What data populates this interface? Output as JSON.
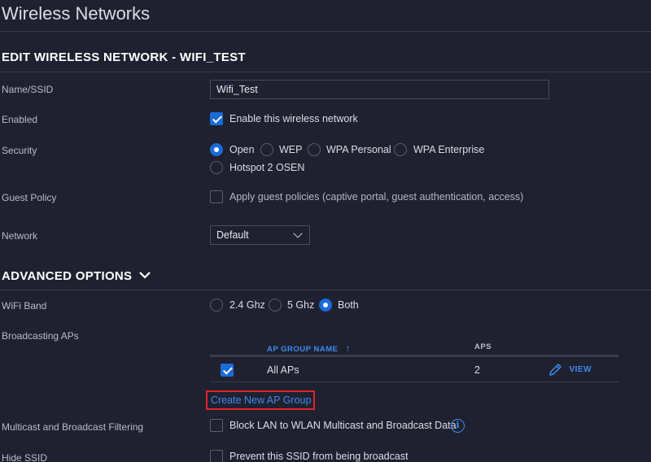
{
  "page": {
    "title": "Wireless Networks"
  },
  "edit": {
    "heading": "EDIT WIRELESS NETWORK - WIFI_TEST"
  },
  "ssid": {
    "label": "Name/SSID",
    "value": "Wifi_Test"
  },
  "enabled": {
    "label": "Enabled",
    "checkbox_label": "Enable this wireless network",
    "checked": true
  },
  "security": {
    "label": "Security",
    "options": [
      "Open",
      "WEP",
      "WPA Personal",
      "WPA Enterprise",
      "Hotspot 2 OSEN"
    ],
    "selected": "Open"
  },
  "guest": {
    "label": "Guest Policy",
    "checkbox_label": "Apply guest policies (captive portal, guest authentication, access)",
    "checked": false
  },
  "network": {
    "label": "Network",
    "value": "Default"
  },
  "advanced": {
    "heading": "ADVANCED OPTIONS"
  },
  "wifi_band": {
    "label": "WiFi Band",
    "options": [
      "2.4 Ghz",
      "5 Ghz",
      "Both"
    ],
    "selected": "Both"
  },
  "broadcasting": {
    "label": "Broadcasting APs",
    "columns": {
      "name": "AP GROUP NAME",
      "sort_arrow": "↑",
      "aps": "APS"
    },
    "rows": [
      {
        "name": "All APs",
        "aps": "2",
        "action": "VIEW",
        "checked": true
      }
    ],
    "create_link": "Create New AP Group"
  },
  "multicast": {
    "label": "Multicast and Broadcast Filtering",
    "checkbox_label": "Block LAN to WLAN Multicast and Broadcast Data",
    "checked": false
  },
  "hide_ssid": {
    "label": "Hide SSID",
    "checkbox_label": "Prevent this SSID from being broadcast",
    "checked": false
  },
  "colors": {
    "accent": "#1b6bd9",
    "link": "#3d8bf0",
    "highlight_box": "#e0242b",
    "background": "#1f2130"
  }
}
